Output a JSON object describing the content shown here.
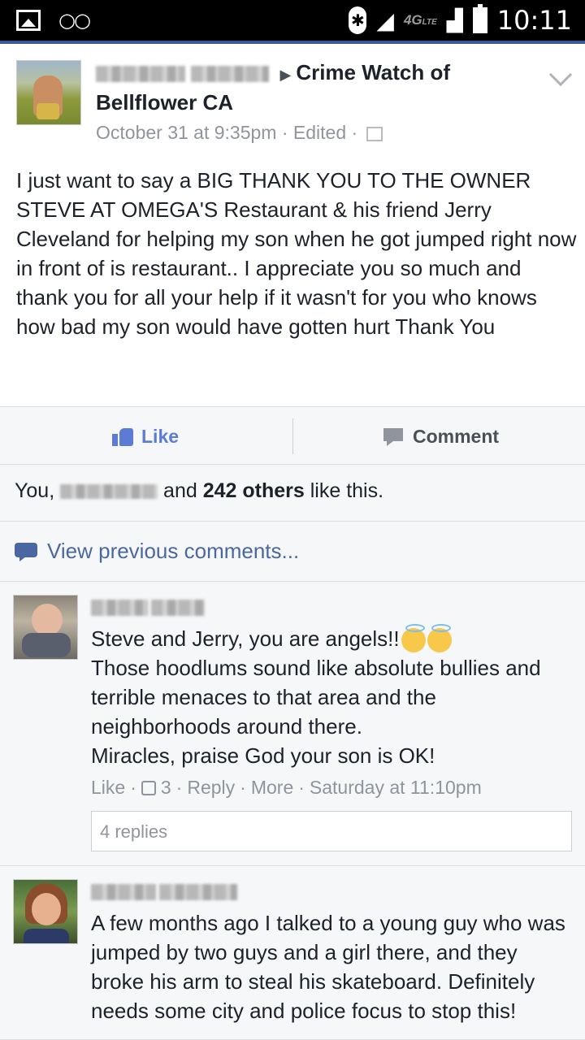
{
  "status_bar": {
    "network": "4G",
    "network_sub": "LTE",
    "time": "10:11"
  },
  "post": {
    "target_group": "Crime Watch of Bellflower CA",
    "timestamp": "October 31 at 9:35pm · Edited ·",
    "body": "I just want to say a BIG THANK YOU TO THE OWNER STEVE AT OMEGA'S Restaurant & his friend Jerry Cleveland for helping my son when he got jumped right now in front of is restaurant.. I appreciate you so much and thank you for all your help if it wasn't for you who knows how bad my son would have gotten hurt Thank You"
  },
  "actions": {
    "like_label": "Like",
    "comment_label": "Comment"
  },
  "likes": {
    "prefix": "You,",
    "middle": "and",
    "count_text": "242 others",
    "suffix": "like this."
  },
  "view_previous": "View previous comments...",
  "comments": [
    {
      "text_lines": [
        "Steve and Jerry, you are angels!!",
        "Those hoodlums sound like absolute bullies and terrible menaces to that area and the neighborhoods around there.",
        "Miracles, praise God your son is OK!"
      ],
      "like": "Like",
      "like_count": "3",
      "reply": "Reply",
      "more": "More",
      "time": "Saturday at 11:10pm",
      "replies": "4 replies"
    },
    {
      "text": "A few months ago I talked to a young guy who was jumped by two guys and a girl there, and they broke his arm to steal his skateboard. Definitely needs some city and police focus to stop this!"
    }
  ]
}
